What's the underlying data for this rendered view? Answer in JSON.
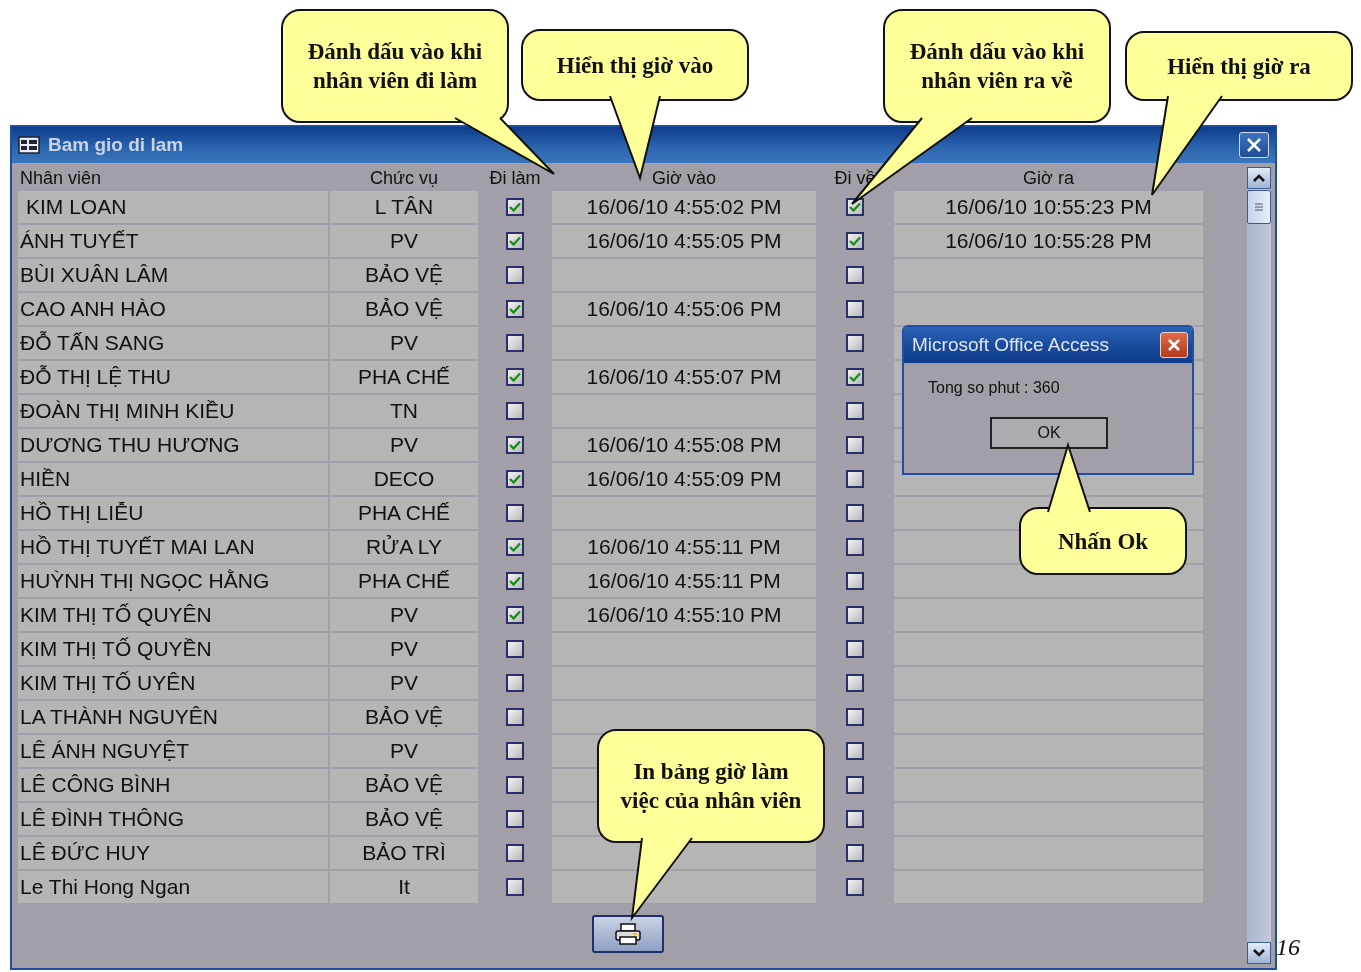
{
  "window": {
    "title": "Bam gio di lam"
  },
  "table": {
    "columns": [
      "Nhân viên",
      "Chức vụ",
      "Đi làm",
      "Giờ vào",
      "Đi về",
      "Giờ ra"
    ],
    "rows": [
      {
        "name": "KIM LOAN",
        "position": "L TÂN",
        "di_lam": true,
        "gio_vao": "16/06/10 4:55:02 PM",
        "di_ve": true,
        "gio_ra": "16/06/10 10:55:23 PM"
      },
      {
        "name": "ÁNH TUYẾT",
        "position": "PV",
        "di_lam": true,
        "gio_vao": "16/06/10 4:55:05 PM",
        "di_ve": true,
        "gio_ra": "16/06/10 10:55:28 PM"
      },
      {
        "name": "BÙI XUÂN LÂM",
        "position": "BẢO VỆ",
        "di_lam": false,
        "di_ve": false
      },
      {
        "name": "CAO ANH HÀO",
        "position": "BẢO VỆ",
        "di_lam": true,
        "gio_vao": "16/06/10 4:55:06 PM",
        "di_ve": false
      },
      {
        "name": "ĐỖ TẤN SANG",
        "position": "PV",
        "di_lam": false,
        "di_ve": false
      },
      {
        "name": "ĐỖ THỊ LỆ THU",
        "position": "PHA CHẾ",
        "di_lam": true,
        "gio_vao": "16/06/10 4:55:07 PM",
        "di_ve": true
      },
      {
        "name": "ĐOÀN THỊ MINH KIỀU",
        "position": "TN",
        "di_lam": false,
        "di_ve": false
      },
      {
        "name": "DƯƠNG THU HƯƠNG",
        "position": "PV",
        "di_lam": true,
        "gio_vao": "16/06/10 4:55:08 PM",
        "di_ve": false
      },
      {
        "name": "HIỀN",
        "position": "DECO",
        "di_lam": true,
        "gio_vao": "16/06/10 4:55:09 PM",
        "di_ve": false
      },
      {
        "name": "HỒ THỊ LIỄU",
        "position": "PHA CHẾ",
        "di_lam": false,
        "di_ve": false
      },
      {
        "name": "HỒ THỊ TUYẾT MAI LAN",
        "position": "RỬA LY",
        "di_lam": true,
        "gio_vao": "16/06/10 4:55:11 PM",
        "di_ve": false
      },
      {
        "name": "HUỲNH THỊ NGỌC HẰNG",
        "position": "PHA CHẾ",
        "di_lam": true,
        "gio_vao": "16/06/10 4:55:11 PM",
        "di_ve": false
      },
      {
        "name": "KIM THỊ TỐ QUYÊN",
        "position": "PV",
        "di_lam": true,
        "gio_vao": "16/06/10 4:55:10 PM",
        "di_ve": false
      },
      {
        "name": "KIM THỊ TỐ QUYỀN",
        "position": "PV",
        "di_lam": false,
        "di_ve": false
      },
      {
        "name": "KIM THỊ TỐ UYÊN",
        "position": "PV",
        "di_lam": false,
        "di_ve": false
      },
      {
        "name": "LA THÀNH NGUYÊN",
        "position": "BẢO VỆ",
        "di_lam": false,
        "di_ve": false
      },
      {
        "name": "LÊ ÁNH NGUYỆT",
        "position": "PV",
        "di_lam": false,
        "di_ve": false
      },
      {
        "name": "LÊ CÔNG BÌNH",
        "position": "BẢO VỆ",
        "di_lam": false,
        "di_ve": false
      },
      {
        "name": "LÊ ĐÌNH THÔNG",
        "position": "BẢO VỆ",
        "di_lam": false,
        "di_ve": false
      },
      {
        "name": "LÊ ĐỨC HUY",
        "position": "BẢO TRÌ",
        "di_lam": false,
        "di_ve": false
      },
      {
        "name": "Le Thi Hong Ngan",
        "position": "It",
        "di_lam": false,
        "di_ve": false
      }
    ]
  },
  "dialog": {
    "title": "Microsoft Office Access",
    "message": "Tong so phut : 360",
    "button": "OK"
  },
  "callouts": [
    {
      "text": "Đánh dấu vào khi nhân viên đi làm"
    },
    {
      "text": "Hiển thị giờ vào"
    },
    {
      "text": "Đánh dấu vào khi nhân viên ra về"
    },
    {
      "text": "Hiển thị giờ ra"
    },
    {
      "text": "Nhấn Ok"
    },
    {
      "text": "In bảng giờ làm việc của nhân viên"
    }
  ],
  "page_number": "16"
}
